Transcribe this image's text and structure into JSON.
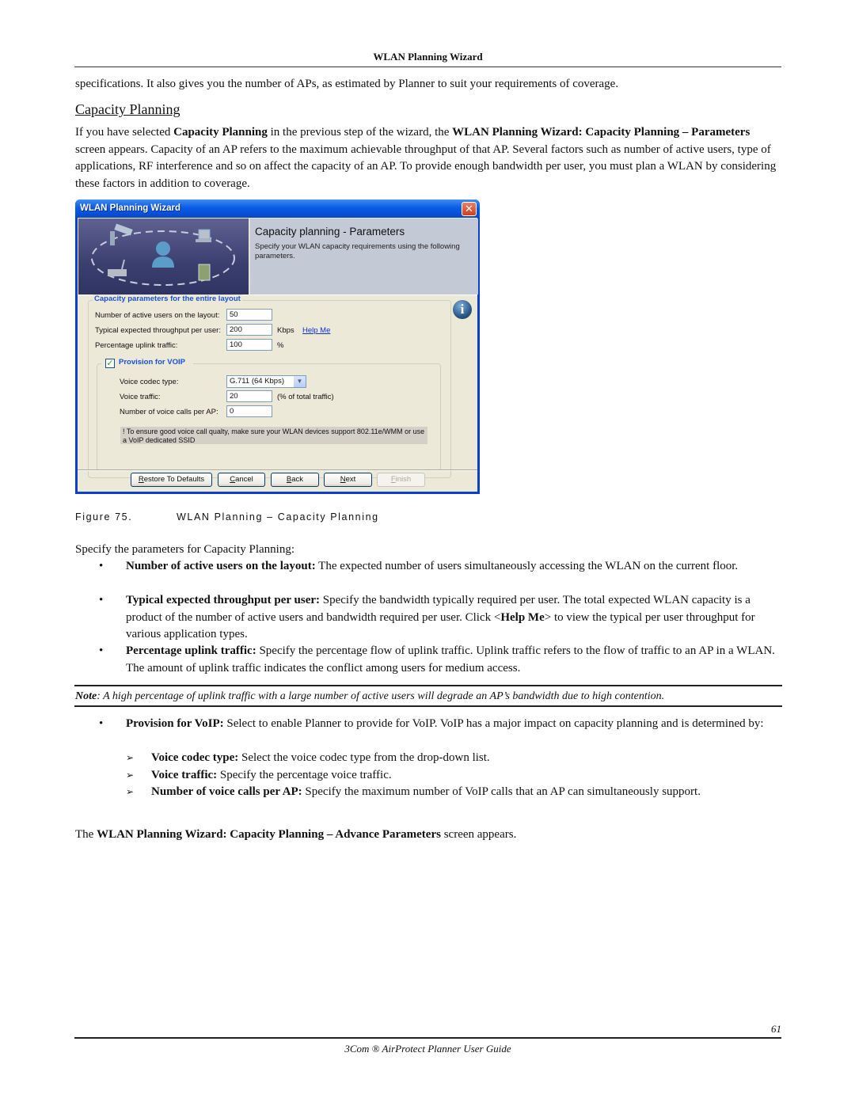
{
  "page": {
    "running_header": "WLAN Planning Wizard",
    "intro_continuation": "specifications. It also gives you the number of APs, as estimated by Planner to suit your requirements of coverage.",
    "section_title": "Capacity Planning",
    "section_para": {
      "p1": "If you have selected ",
      "b1": "Capacity Planning",
      "p2": " in the previous step of the wizard, the ",
      "b2": "WLAN Planning Wizard: Capacity Planning – Parameters",
      "p3": " screen appears. Capacity of an AP refers to the maximum achievable throughput of that AP. Several factors such as number of active users, type of applications, RF interference and so on affect the capacity of an AP. To provide enough bandwidth per user, you must plan a WLAN by considering these factors in addition to coverage."
    },
    "figure": {
      "number": "Figure 75.",
      "title": "WLAN Planning – Capacity Planning"
    },
    "specify_intro": "Specify the parameters for Capacity Planning:",
    "bullets": [
      {
        "term": "Number of active users on the layout:",
        "text": " The expected number of users simultaneously accessing the WLAN on the current floor."
      },
      {
        "term": "Typical expected throughput per user:",
        "text": " Specify the bandwidth typically required per user. The total expected WLAN capacity is a product of the number of active users and bandwidth required per user. Click <",
        "term2": "Help Me",
        "text2": "> to view the typical per user throughput for various application types."
      },
      {
        "term": "Percentage uplink traffic:",
        "text": " Specify the percentage flow of uplink traffic. Uplink traffic refers to the flow of traffic to an AP in a WLAN. The amount of uplink traffic indicates the conflict among users for medium access."
      }
    ],
    "note": {
      "label": "Note",
      "text": ": A high percentage of uplink traffic with a large number of active users will degrade an AP’s bandwidth due to high contention."
    },
    "voip_bullet": {
      "term": "Provision for VoIP:",
      "text": " Select to enable Planner to provide for VoIP. VoIP has a major impact on capacity planning and is determined by:"
    },
    "sub_bullets": [
      {
        "term": "Voice codec type:",
        "text": " Select the voice codec type from the drop-down list."
      },
      {
        "term": "Voice traffic:",
        "text": " Specify the percentage voice traffic."
      },
      {
        "term": "Number of voice calls per AP:",
        "text": " Specify the maximum number of VoIP calls that an AP can simultaneously support."
      }
    ],
    "closing": {
      "p1": "The ",
      "b1": "WLAN Planning Wizard: Capacity Planning – Advance Parameters",
      "p2": " screen appears."
    },
    "page_number": "61",
    "footer": "3Com ® AirProtect Planner User Guide"
  },
  "dialog": {
    "title": "WLAN Planning Wizard",
    "close_glyph": "✕",
    "banner_heading": "Capacity planning - Parameters",
    "banner_sub": "Specify your WLAN capacity requirements using the following parameters.",
    "info_glyph": "i",
    "group1_title": "Capacity parameters for the entire layout",
    "fields": {
      "active_users_label": "Number of active users on the layout:",
      "active_users_value": "50",
      "throughput_label": "Typical expected throughput per user:",
      "throughput_value": "200",
      "throughput_unit": "Kbps",
      "help_link": "Help Me",
      "uplink_label": "Percentage uplink traffic:",
      "uplink_value": "100",
      "uplink_unit": "%"
    },
    "voip": {
      "checkbox_checked": true,
      "check_glyph": "✓",
      "title": "Provision for VOIP",
      "codec_label": "Voice codec type:",
      "codec_value": "G.711 (64 Kbps)",
      "dropdown_glyph": "▼",
      "traffic_label": "Voice traffic:",
      "traffic_value": "20",
      "traffic_unit": "(% of total traffic)",
      "calls_label": "Number of voice calls per AP:",
      "calls_value": "0",
      "warning": "! To ensure good voice call qualty, make sure your WLAN devices support 802.11e/WMM or use a VoIP dedicated SSID"
    },
    "buttons": {
      "restore_mnemonic": "R",
      "restore_rest": "estore To Defaults",
      "cancel_mnemonic": "C",
      "cancel_rest": "ancel",
      "back_mnemonic": "B",
      "back_rest": "ack",
      "next_mnemonic": "N",
      "next_rest": "ext",
      "finish_mnemonic": "F",
      "finish_rest": "inish"
    }
  }
}
